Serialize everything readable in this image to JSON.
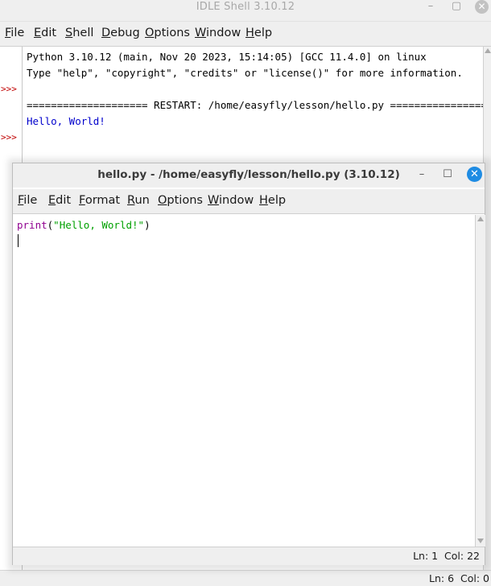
{
  "shell": {
    "title": "IDLE Shell 3.10.12",
    "menu": [
      "File",
      "Edit",
      "Shell",
      "Debug",
      "Options",
      "Window",
      "Help"
    ],
    "prompt": ">>>",
    "output": {
      "line1": "Python 3.10.12 (main, Nov 20 2023, 15:14:05) [GCC 11.4.0] on linux",
      "line2": "Type \"help\", \"copyright\", \"credits\" or \"license()\" for more information.",
      "restart": "==================== RESTART: /home/easyfly/lesson/hello.py ====================",
      "result": "Hello, World!"
    },
    "status": "Ln: 6  Col: 0"
  },
  "editor": {
    "title": "hello.py - /home/easyfly/lesson/hello.py (3.10.12)",
    "menu": [
      "File",
      "Edit",
      "Format",
      "Run",
      "Options",
      "Window",
      "Help"
    ],
    "code": {
      "func": "print",
      "open": "(",
      "string": "\"Hello, World!\"",
      "close": ")"
    },
    "status": "Ln: 1  Col: 22"
  },
  "colors": {
    "prompt": "#c00000",
    "output_text": "#0000cc",
    "keyword": "#900090",
    "string": "#00a000",
    "close_button": "#1f8ce3"
  }
}
